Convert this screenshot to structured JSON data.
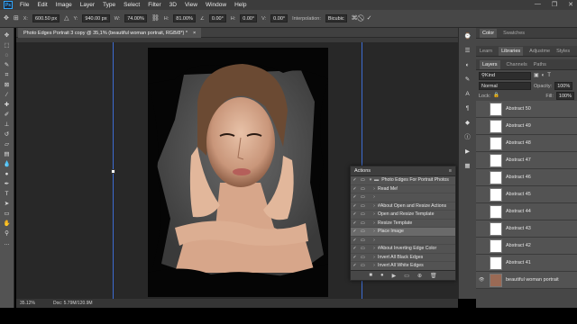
{
  "menu": {
    "app_logo": "Ps",
    "items": [
      "File",
      "Edit",
      "Image",
      "Layer",
      "Type",
      "Select",
      "Filter",
      "3D",
      "View",
      "Window",
      "Help"
    ],
    "window_controls": [
      "—",
      "❐",
      "✕"
    ]
  },
  "options": {
    "x_label": "X:",
    "x_value": "600.50 px",
    "y_label": "Y:",
    "y_value": "940.00 px",
    "w_label": "W:",
    "w_value": "74.00%",
    "h_label": "H:",
    "h_value": "81.00%",
    "angle_label": "∠",
    "angle_value": "0.00°",
    "hskew_label": "H:",
    "hskew_value": "0.00°",
    "vskew_label": "V:",
    "vskew_value": "0.00°",
    "interpolation_label": "Interpolation:",
    "interpolation_value": "Bicubic"
  },
  "document": {
    "tab_title": "Photo Edges Portrait 3 copy @ 35,1% (beautiful woman portrait, RGB/8*) *",
    "close": "×"
  },
  "status": {
    "zoom": "35.12%",
    "doc_info": "Doc: 5.79M/120.9M"
  },
  "panels": {
    "top_tabs": [
      "Color",
      "Swatches"
    ],
    "mid_tabs": [
      "Learn",
      "Libraries",
      "Adjustme",
      "Styles"
    ],
    "layer_tabs": [
      "Layers",
      "Channels",
      "Paths"
    ],
    "kind_label": "Kind",
    "blend_mode": "Normal",
    "opacity_label": "Opacity:",
    "opacity_value": "100%",
    "lock_label": "Lock:",
    "fill_label": "Fill:",
    "fill_value": "100%",
    "layers": [
      "Abstract 50",
      "Abstract 49",
      "Abstract 48",
      "Abstract 47",
      "Abstract 46",
      "Abstract 45",
      "Abstract 44",
      "Abstract 43",
      "Abstract 42",
      "Abstract 41",
      "beautiful woman portrait"
    ]
  },
  "actions_panel": {
    "title": "Actions",
    "rows": [
      {
        "label": "Photo Edges For Portrait Photos",
        "sel": false,
        "indent": 0
      },
      {
        "label": "Read Me!",
        "sel": false,
        "indent": 1
      },
      {
        "label": "",
        "sel": false,
        "indent": 1
      },
      {
        "label": "#About Open and Resize Actions",
        "sel": false,
        "indent": 1
      },
      {
        "label": "Open and Resize Template",
        "sel": false,
        "indent": 1
      },
      {
        "label": "Resize Template",
        "sel": false,
        "indent": 1
      },
      {
        "label": "Place Image",
        "sel": true,
        "indent": 1
      },
      {
        "label": "",
        "sel": false,
        "indent": 1
      },
      {
        "label": "#About Inverting Edge Color",
        "sel": false,
        "indent": 1
      },
      {
        "label": "Invert All Black Edges",
        "sel": false,
        "indent": 1
      },
      {
        "label": "Invert All White Edges",
        "sel": false,
        "indent": 1
      }
    ]
  },
  "colors": {
    "accent": "#31a8ff",
    "foreground_swatch": "#e0301e",
    "guide": "#3d6cd1"
  }
}
